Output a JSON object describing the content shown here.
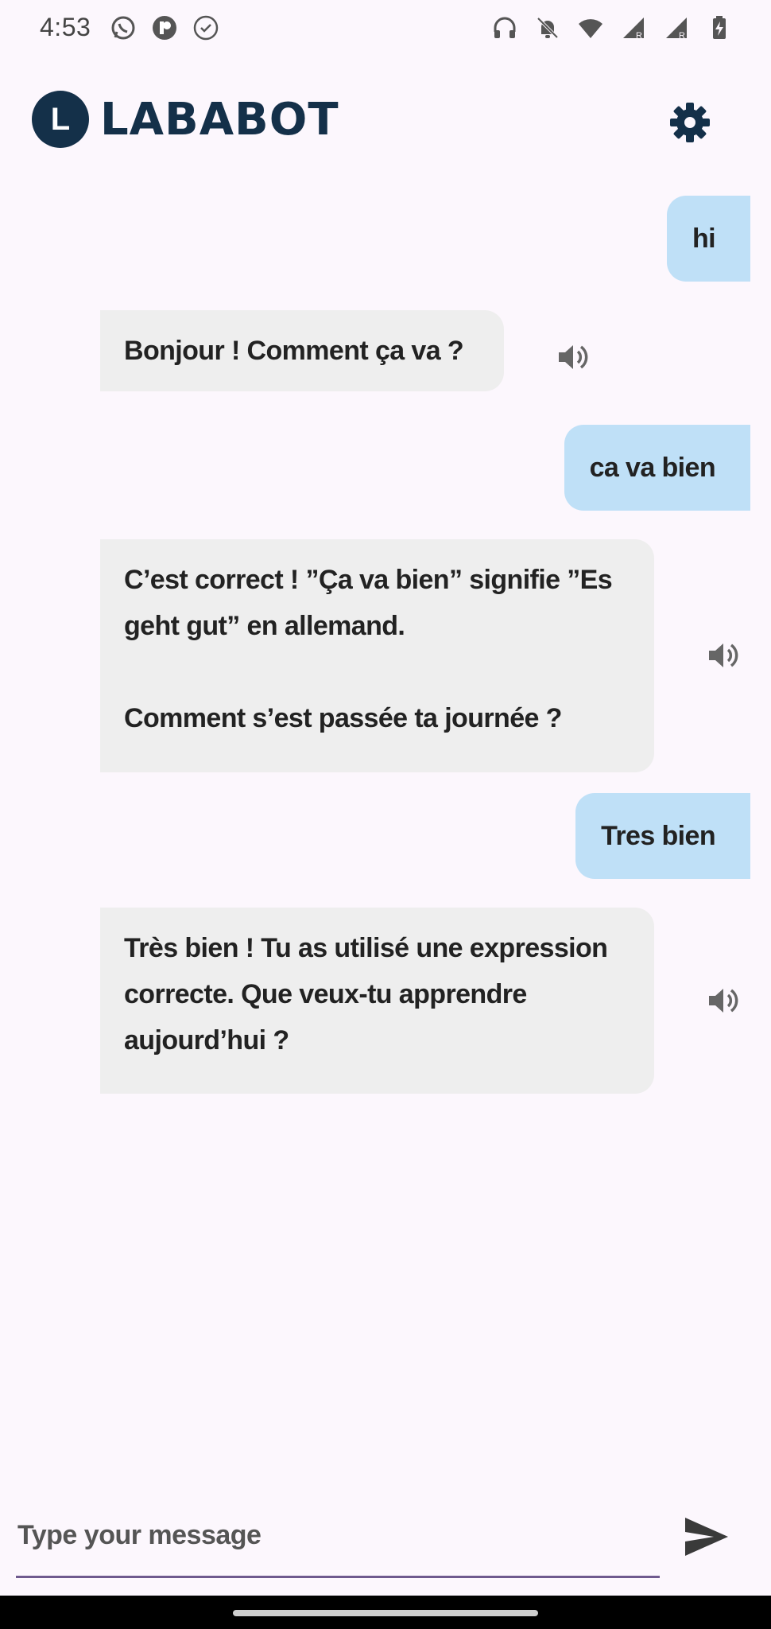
{
  "status_bar": {
    "time": "4:53",
    "left_icons": [
      "whatsapp-icon",
      "app-icon",
      "check-circle-icon"
    ],
    "right_icons": [
      "headphones-icon",
      "bell-off-icon",
      "wifi-icon",
      "signal-r-icon",
      "signal-r-icon",
      "battery-charging-icon"
    ]
  },
  "header": {
    "logo_letter": "L",
    "logo_text": "LABABOT",
    "settings_icon": "gear-icon"
  },
  "messages": [
    {
      "role": "user",
      "text": "hi"
    },
    {
      "role": "bot",
      "text": "Bonjour ! Comment ça va ?"
    },
    {
      "role": "user",
      "text": "ca va bien"
    },
    {
      "role": "bot",
      "lines": [
        "C’est correct ! ”Ça va bien” signifie ”Es",
        "geht gut” en allemand.",
        "",
        "Comment s’est passée ta journée ?"
      ]
    },
    {
      "role": "user",
      "text": "Tres bien"
    },
    {
      "role": "bot",
      "lines": [
        "Très bien ! Tu as utilisé une expression",
        "correcte. Que veux-tu apprendre",
        "aujourd’hui ?"
      ]
    }
  ],
  "input": {
    "placeholder": "Type your message",
    "value": ""
  },
  "colors": {
    "background": "#fcf7fd",
    "user_bubble": "#bfe0f7",
    "bot_bubble": "#eeeeee",
    "brand": "#143049",
    "input_underline": "#6f5a8e"
  }
}
